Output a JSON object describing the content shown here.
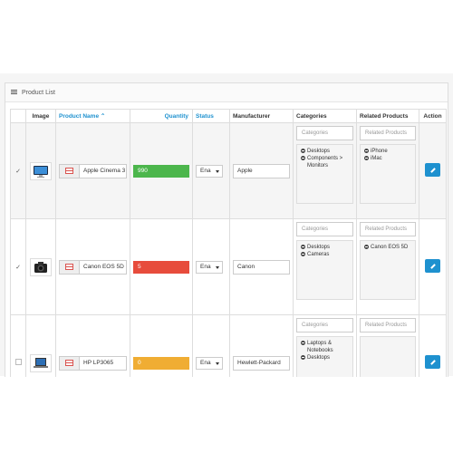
{
  "panel": {
    "title": "Product List",
    "icon": "list-icon"
  },
  "columns": {
    "image": "Image",
    "product_name": "Product Name",
    "quantity": "Quantity",
    "status": "Status",
    "manufacturer": "Manufacturer",
    "categories": "Categories",
    "related_products": "Related Products",
    "action": "Action"
  },
  "sort": {
    "column": "product_name",
    "indicator": "⌃"
  },
  "placeholders": {
    "categories": "Categories",
    "related": "Related Products"
  },
  "rows": [
    {
      "checked": true,
      "checkmark": "✓",
      "thumb": "monitor-thumb",
      "name": "Apple Cinema 3",
      "quantity": "990",
      "quantity_color": "#4cb64c",
      "status": "Ena",
      "manufacturer": "Apple",
      "categories": [
        "Desktops",
        "Components > Monitors"
      ],
      "related": [
        "iPhone",
        "iMac"
      ]
    },
    {
      "checked": true,
      "checkmark": "✓",
      "thumb": "camera-thumb",
      "name": "Canon EOS 5D",
      "quantity": "5",
      "quantity_color": "#e74c3c",
      "status": "Ena",
      "manufacturer": "Canon",
      "categories": [
        "Desktops",
        "Cameras"
      ],
      "related": [
        "Canon EOS 5D"
      ]
    },
    {
      "checked": false,
      "checkmark": "",
      "thumb": "laptop-thumb",
      "name": "HP LP3065",
      "quantity": "0",
      "quantity_color": "#f0ad33",
      "status": "Ena",
      "manufacturer": "Hewlett-Packard",
      "categories": [
        "Laptops & Notebooks",
        "Desktops"
      ],
      "related": []
    }
  ],
  "colors": {
    "link": "#1e91cf",
    "edit_button": "#1e91cf"
  }
}
